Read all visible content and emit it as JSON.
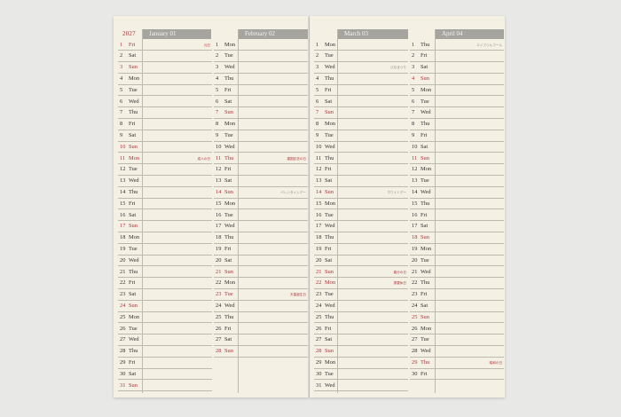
{
  "year": "2027",
  "months": [
    {
      "title": "January 01",
      "days": [
        {
          "n": "1",
          "w": "Fri",
          "red": true
        },
        {
          "n": "2",
          "w": "Sat"
        },
        {
          "n": "3",
          "w": "Sun",
          "red": true
        },
        {
          "n": "4",
          "w": "Mon"
        },
        {
          "n": "5",
          "w": "Tue"
        },
        {
          "n": "6",
          "w": "Wed"
        },
        {
          "n": "7",
          "w": "Thu"
        },
        {
          "n": "8",
          "w": "Fri"
        },
        {
          "n": "9",
          "w": "Sat"
        },
        {
          "n": "10",
          "w": "Sun",
          "red": true
        },
        {
          "n": "11",
          "w": "Mon",
          "red": true
        },
        {
          "n": "12",
          "w": "Tue"
        },
        {
          "n": "13",
          "w": "Wed"
        },
        {
          "n": "14",
          "w": "Thu"
        },
        {
          "n": "15",
          "w": "Fri"
        },
        {
          "n": "16",
          "w": "Sat"
        },
        {
          "n": "17",
          "w": "Sun",
          "red": true
        },
        {
          "n": "18",
          "w": "Mon"
        },
        {
          "n": "19",
          "w": "Tue"
        },
        {
          "n": "20",
          "w": "Wed"
        },
        {
          "n": "21",
          "w": "Thu"
        },
        {
          "n": "22",
          "w": "Fri"
        },
        {
          "n": "23",
          "w": "Sat"
        },
        {
          "n": "24",
          "w": "Sun",
          "red": true
        },
        {
          "n": "25",
          "w": "Mon"
        },
        {
          "n": "26",
          "w": "Tue"
        },
        {
          "n": "27",
          "w": "Wed"
        },
        {
          "n": "28",
          "w": "Thu"
        },
        {
          "n": "29",
          "w": "Fri"
        },
        {
          "n": "30",
          "w": "Sat"
        },
        {
          "n": "31",
          "w": "Sun",
          "red": true
        }
      ],
      "notes": [
        {
          "row": 0,
          "text": "元日",
          "red": true
        },
        {
          "row": 10,
          "text": "成人の日",
          "red": true
        }
      ]
    },
    {
      "title": "February 02",
      "days": [
        {
          "n": "1",
          "w": "Mon"
        },
        {
          "n": "2",
          "w": "Tue"
        },
        {
          "n": "3",
          "w": "Wed"
        },
        {
          "n": "4",
          "w": "Thu"
        },
        {
          "n": "5",
          "w": "Fri"
        },
        {
          "n": "6",
          "w": "Sat"
        },
        {
          "n": "7",
          "w": "Sun",
          "red": true
        },
        {
          "n": "8",
          "w": "Mon"
        },
        {
          "n": "9",
          "w": "Tue"
        },
        {
          "n": "10",
          "w": "Wed"
        },
        {
          "n": "11",
          "w": "Thu",
          "red": true
        },
        {
          "n": "12",
          "w": "Fri"
        },
        {
          "n": "13",
          "w": "Sat"
        },
        {
          "n": "14",
          "w": "Sun",
          "red": true
        },
        {
          "n": "15",
          "w": "Mon"
        },
        {
          "n": "16",
          "w": "Tue"
        },
        {
          "n": "17",
          "w": "Wed"
        },
        {
          "n": "18",
          "w": "Thu"
        },
        {
          "n": "19",
          "w": "Fri"
        },
        {
          "n": "20",
          "w": "Sat"
        },
        {
          "n": "21",
          "w": "Sun",
          "red": true
        },
        {
          "n": "22",
          "w": "Mon"
        },
        {
          "n": "23",
          "w": "Tue",
          "red": true
        },
        {
          "n": "24",
          "w": "Wed"
        },
        {
          "n": "25",
          "w": "Thu"
        },
        {
          "n": "26",
          "w": "Fri"
        },
        {
          "n": "27",
          "w": "Sat"
        },
        {
          "n": "28",
          "w": "Sun",
          "red": true
        }
      ],
      "notes": [
        {
          "row": 10,
          "text": "建国記念の日",
          "red": true
        },
        {
          "row": 13,
          "text": "バレンタインデー",
          "red": false
        },
        {
          "row": 22,
          "text": "天皇誕生日",
          "red": true
        }
      ]
    },
    {
      "title": "March 03",
      "days": [
        {
          "n": "1",
          "w": "Mon"
        },
        {
          "n": "2",
          "w": "Tue"
        },
        {
          "n": "3",
          "w": "Wed"
        },
        {
          "n": "4",
          "w": "Thu"
        },
        {
          "n": "5",
          "w": "Fri"
        },
        {
          "n": "6",
          "w": "Sat"
        },
        {
          "n": "7",
          "w": "Sun",
          "red": true
        },
        {
          "n": "8",
          "w": "Mon"
        },
        {
          "n": "9",
          "w": "Tue"
        },
        {
          "n": "10",
          "w": "Wed"
        },
        {
          "n": "11",
          "w": "Thu"
        },
        {
          "n": "12",
          "w": "Fri"
        },
        {
          "n": "13",
          "w": "Sat"
        },
        {
          "n": "14",
          "w": "Sun",
          "red": true
        },
        {
          "n": "15",
          "w": "Mon"
        },
        {
          "n": "16",
          "w": "Tue"
        },
        {
          "n": "17",
          "w": "Wed"
        },
        {
          "n": "18",
          "w": "Thu"
        },
        {
          "n": "19",
          "w": "Fri"
        },
        {
          "n": "20",
          "w": "Sat"
        },
        {
          "n": "21",
          "w": "Sun",
          "red": true
        },
        {
          "n": "22",
          "w": "Mon",
          "red": true
        },
        {
          "n": "23",
          "w": "Tue"
        },
        {
          "n": "24",
          "w": "Wed"
        },
        {
          "n": "25",
          "w": "Thu"
        },
        {
          "n": "26",
          "w": "Fri"
        },
        {
          "n": "27",
          "w": "Sat"
        },
        {
          "n": "28",
          "w": "Sun",
          "red": true
        },
        {
          "n": "29",
          "w": "Mon"
        },
        {
          "n": "30",
          "w": "Tue"
        },
        {
          "n": "31",
          "w": "Wed"
        }
      ],
      "notes": [
        {
          "row": 2,
          "text": "ひなまつり",
          "red": false
        },
        {
          "row": 13,
          "text": "ホワイトデー",
          "red": false
        },
        {
          "row": 20,
          "text": "春分の日",
          "red": true
        },
        {
          "row": 21,
          "text": "振替休日",
          "red": true
        }
      ]
    },
    {
      "title": "April 04",
      "days": [
        {
          "n": "1",
          "w": "Thu"
        },
        {
          "n": "2",
          "w": "Fri"
        },
        {
          "n": "3",
          "w": "Sat"
        },
        {
          "n": "4",
          "w": "Sun",
          "red": true
        },
        {
          "n": "5",
          "w": "Mon"
        },
        {
          "n": "6",
          "w": "Tue"
        },
        {
          "n": "7",
          "w": "Wed"
        },
        {
          "n": "8",
          "w": "Thu"
        },
        {
          "n": "9",
          "w": "Fri"
        },
        {
          "n": "10",
          "w": "Sat"
        },
        {
          "n": "11",
          "w": "Sun",
          "red": true
        },
        {
          "n": "12",
          "w": "Mon"
        },
        {
          "n": "13",
          "w": "Tue"
        },
        {
          "n": "14",
          "w": "Wed"
        },
        {
          "n": "15",
          "w": "Thu"
        },
        {
          "n": "16",
          "w": "Fri"
        },
        {
          "n": "17",
          "w": "Sat"
        },
        {
          "n": "18",
          "w": "Sun",
          "red": true
        },
        {
          "n": "19",
          "w": "Mon"
        },
        {
          "n": "20",
          "w": "Tue"
        },
        {
          "n": "21",
          "w": "Wed"
        },
        {
          "n": "22",
          "w": "Thu"
        },
        {
          "n": "23",
          "w": "Fri"
        },
        {
          "n": "24",
          "w": "Sat"
        },
        {
          "n": "25",
          "w": "Sun",
          "red": true
        },
        {
          "n": "26",
          "w": "Mon"
        },
        {
          "n": "27",
          "w": "Tue"
        },
        {
          "n": "28",
          "w": "Wed"
        },
        {
          "n": "29",
          "w": "Thu",
          "red": true
        },
        {
          "n": "30",
          "w": "Fri"
        }
      ],
      "notes": [
        {
          "row": 0,
          "text": "エイプリルフール",
          "red": false
        },
        {
          "row": 28,
          "text": "昭和の日",
          "red": true
        }
      ]
    }
  ]
}
